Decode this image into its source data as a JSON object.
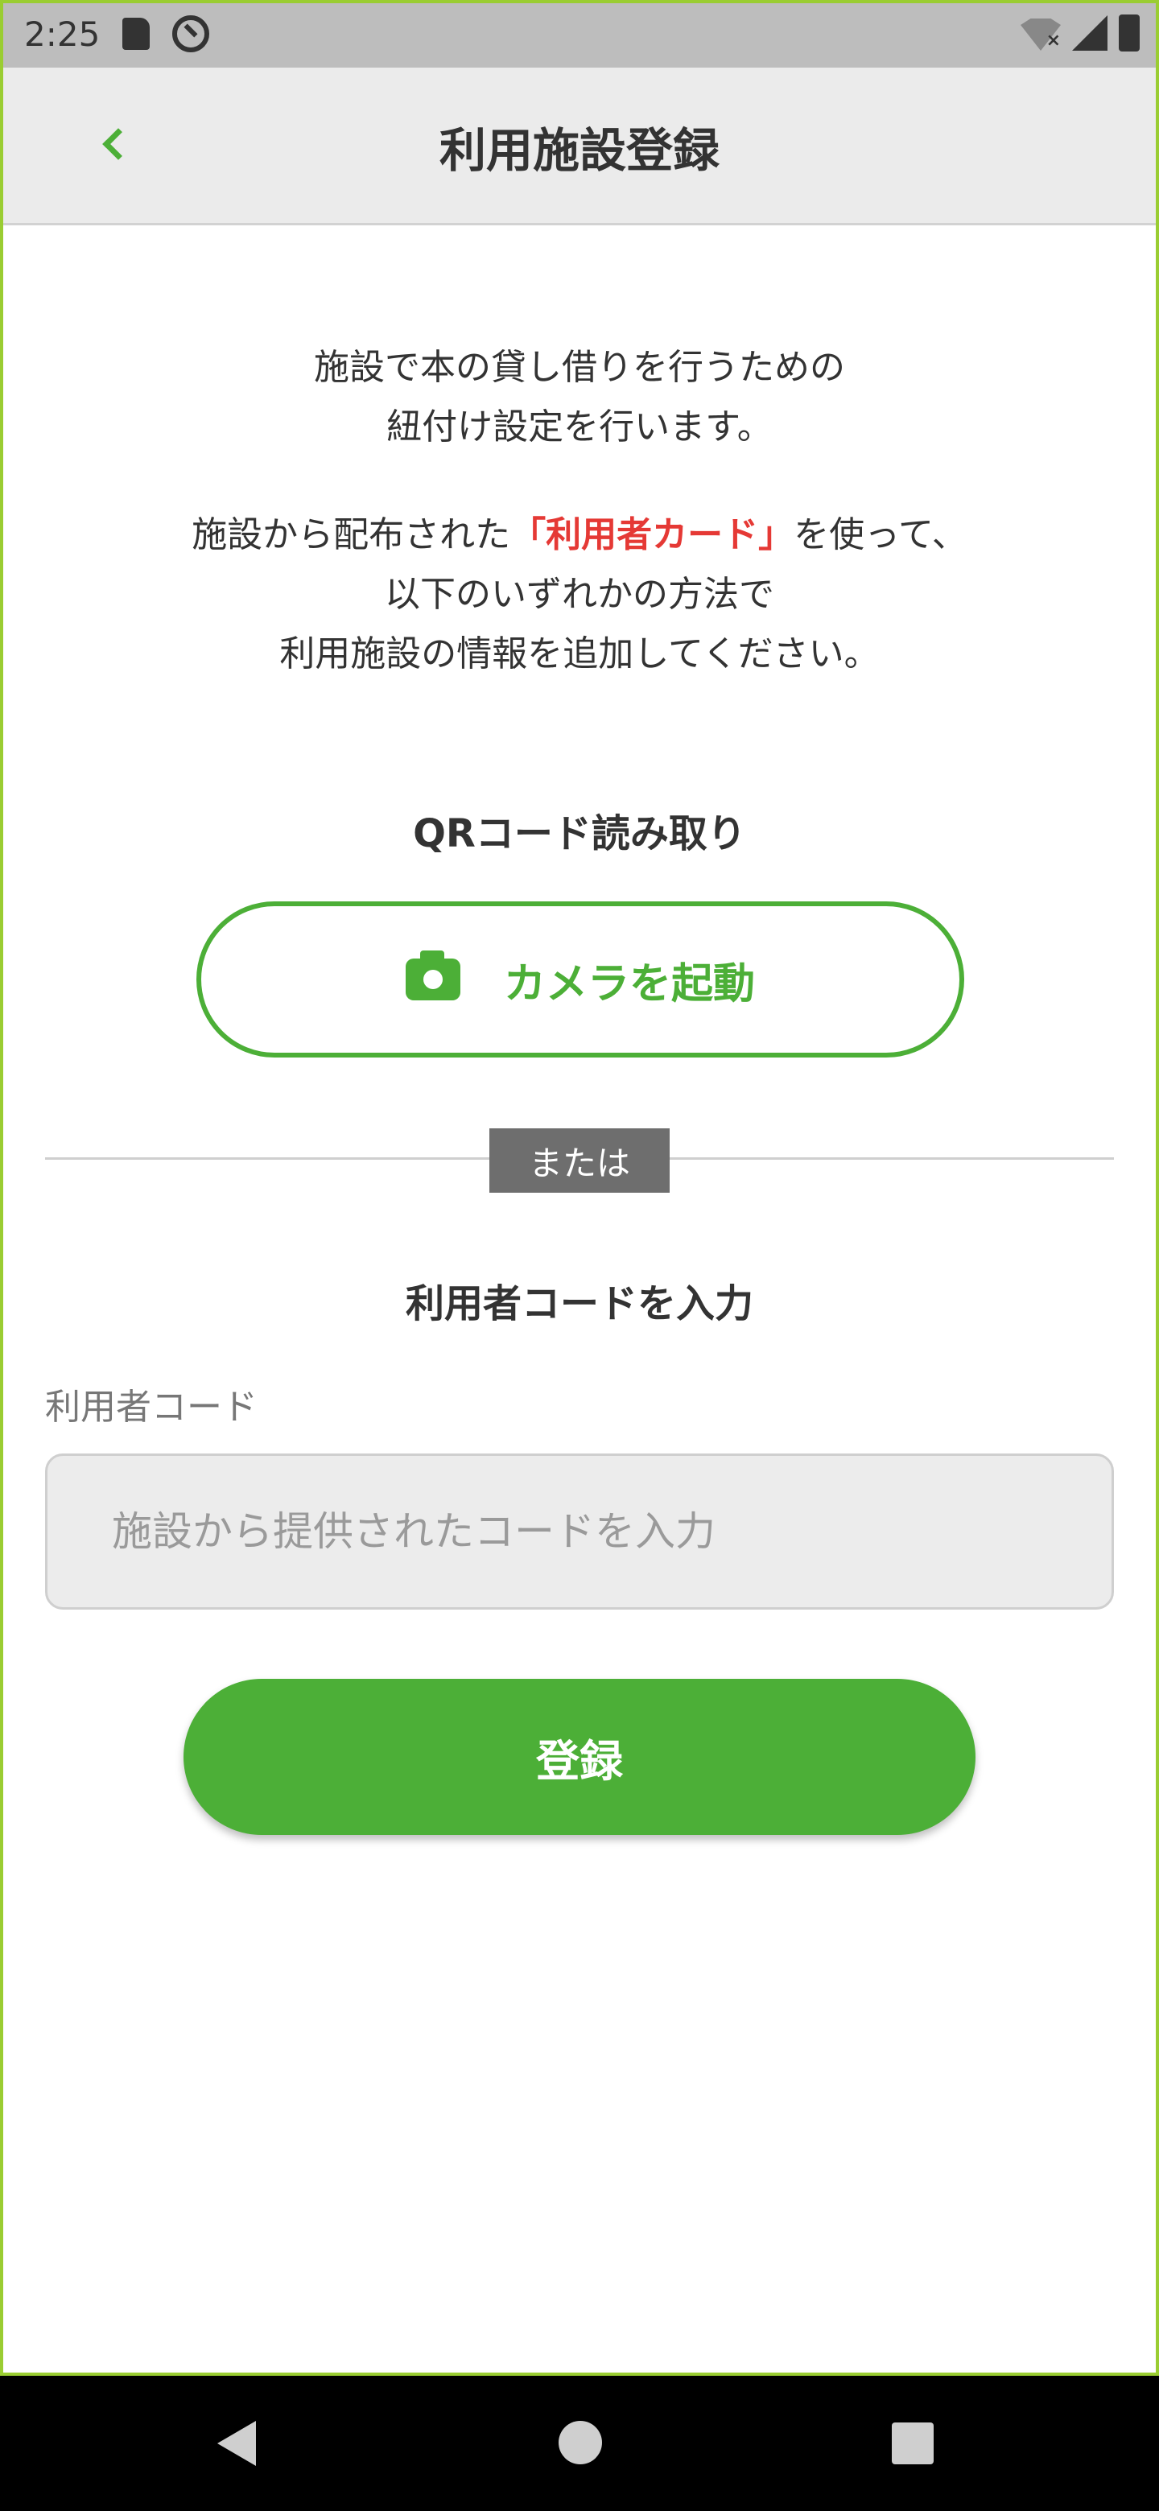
{
  "status_bar": {
    "time": "2:25"
  },
  "header": {
    "title": "利用施設登録"
  },
  "intro": {
    "line1": "施設で本の貸し借りを行うための",
    "line2": "紐付け設定を行います。",
    "line3_prefix": "施設から配布された",
    "line3_highlight": "「利用者カード」",
    "line3_suffix": "を使って、",
    "line4": "以下のいずれかの方法で",
    "line5": "利用施設の情報を追加してください。"
  },
  "qr_section": {
    "title": "QRコード読み取り",
    "camera_button_label": "カメラを起動"
  },
  "divider": {
    "label": "または"
  },
  "code_section": {
    "title": "利用者コードを入力",
    "field_label": "利用者コード",
    "placeholder": "施設から提供されたコードを入力",
    "value": ""
  },
  "register_button_label": "登録",
  "colors": {
    "accent": "#4caf37",
    "highlight": "#e53935",
    "frame": "#9acd32"
  },
  "icons": [
    "sd-card-icon",
    "at-sign-icon",
    "wifi-off-icon",
    "signal-icon",
    "battery-icon",
    "chevron-left-icon",
    "camera-icon",
    "nav-back-icon",
    "nav-home-icon",
    "nav-recent-icon"
  ]
}
